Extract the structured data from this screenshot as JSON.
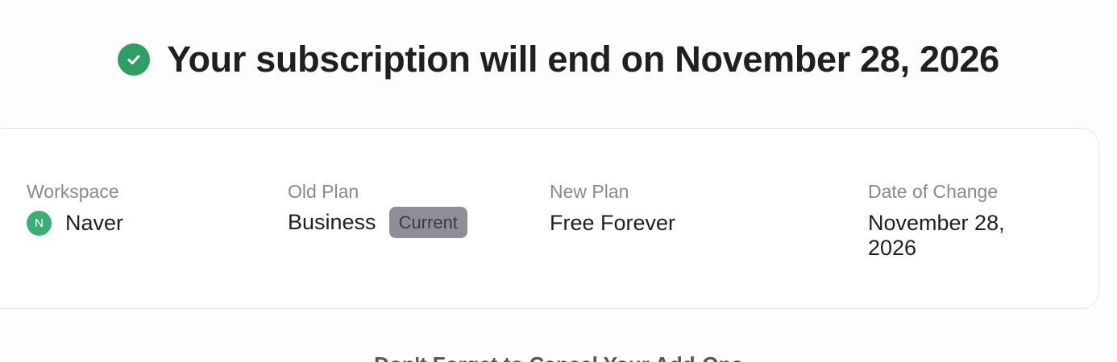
{
  "headline": {
    "text": "Your subscription will end on November 28, 2026",
    "icon": "check-circle-icon",
    "icon_color": "#2e9e62"
  },
  "summary": {
    "workspace": {
      "label": "Workspace",
      "avatar_initial": "N",
      "avatar_color": "#3aaf72",
      "name": "Naver"
    },
    "old_plan": {
      "label": "Old Plan",
      "value": "Business",
      "badge": "Current"
    },
    "new_plan": {
      "label": "New Plan",
      "value": "Free Forever"
    },
    "date_of_change": {
      "label": "Date of Change",
      "value": "November 28, 2026"
    }
  },
  "addons_heading": "Don't Forget to Cancel Your Add-Ons"
}
